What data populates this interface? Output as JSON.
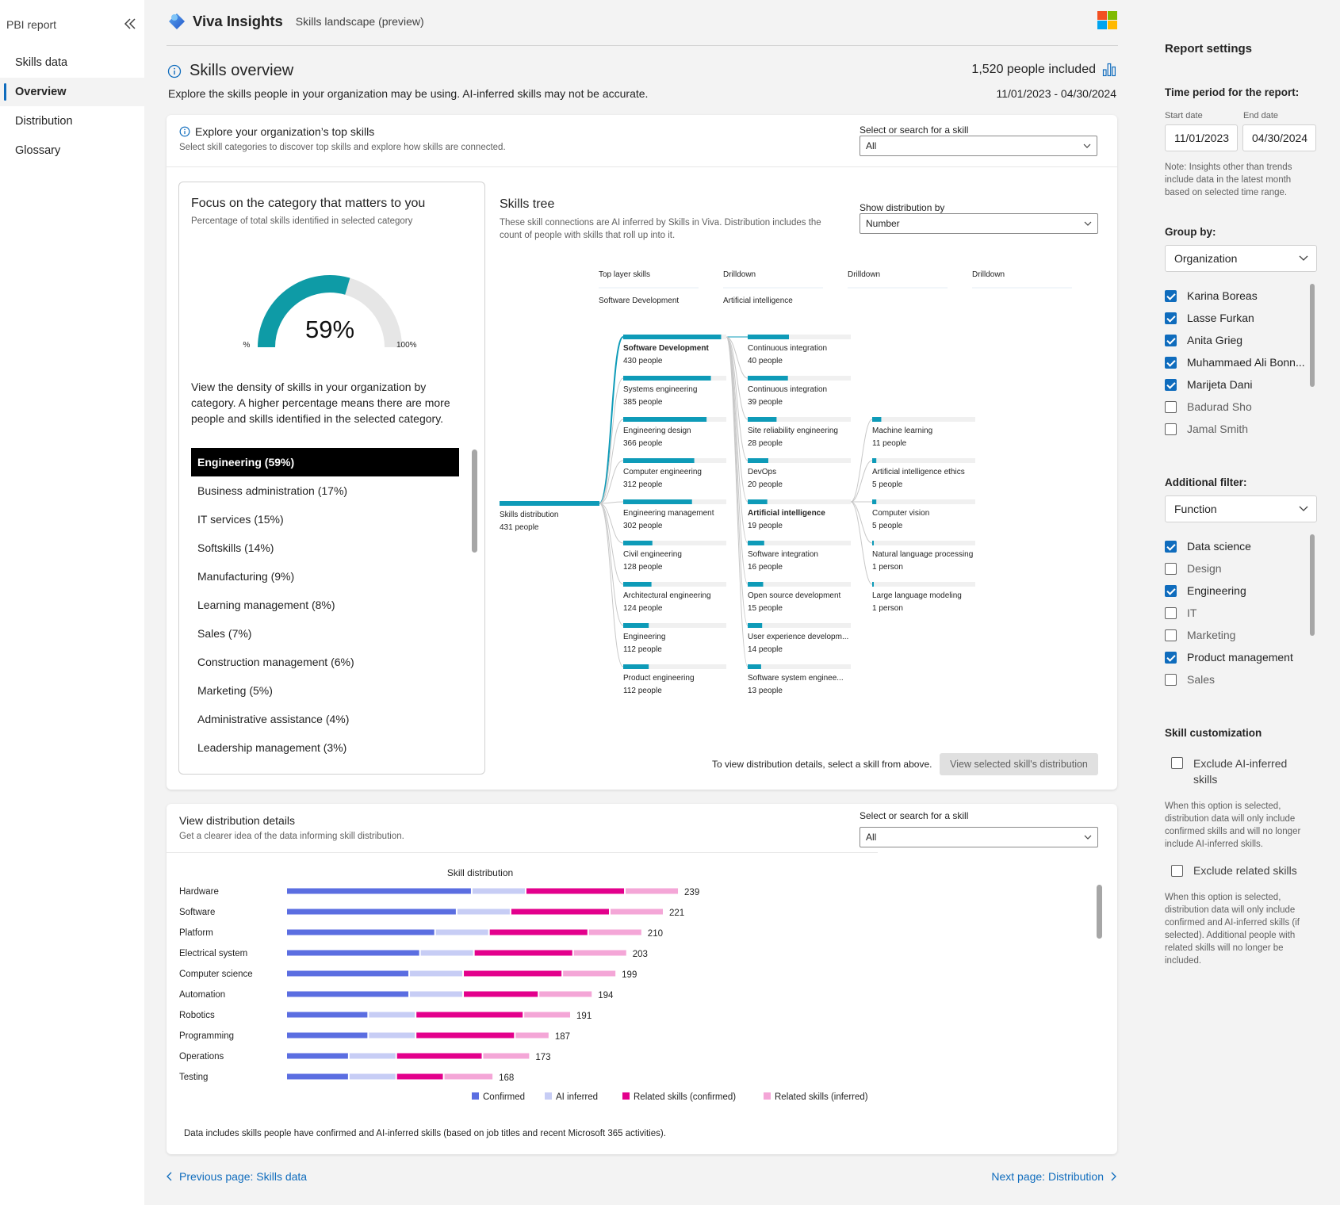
{
  "nav": {
    "title": "PBI report",
    "items": [
      "Skills data",
      "Overview",
      "Distribution",
      "Glossary"
    ],
    "active_index": 1
  },
  "header": {
    "brand": "Viva Insights",
    "subtitle": "Skills landscape (preview)"
  },
  "overview": {
    "title": "Skills overview",
    "description": "Explore the skills people in your organization may be using. AI-inferred skills may not be accurate.",
    "people_included": "1,520 people included",
    "date_range": "11/01/2023 - 04/30/2024"
  },
  "top_card": {
    "title": "Explore your organization’s top skills",
    "subtitle": "Select skill categories to discover top skills and explore how skills are connected.",
    "select_label": "Select or search for a skill",
    "select_value": "All"
  },
  "focus": {
    "title": "Focus on the category that matters to you",
    "subtitle": "Percentage of total skills identified in selected category",
    "gauge_value": 59,
    "gauge_label": "59%",
    "gauge_min": "0%",
    "gauge_max": "100%",
    "description": "View the density of skills in your organization by category. A higher percentage means there are more people and skills identified in the selected category.",
    "categories": [
      "Engineering (59%)",
      "Business administration (17%)",
      "IT services (15%)",
      "Softskills (14%)",
      "Manufacturing (9%)",
      "Learning management (8%)",
      "Sales (7%)",
      "Construction management (6%)",
      "Marketing (5%)",
      "Administrative assistance (4%)",
      "Leadership management (3%)"
    ]
  },
  "tree": {
    "title": "Skills tree",
    "subtitle": "These skill connections are AI inferred by Skills in Viva. Distribution includes the count of people with skills that roll up into it.",
    "show_by_label": "Show distribution by",
    "show_by_value": "Number",
    "col_headers": [
      "Top layer skills",
      "Drilldown",
      "Drilldown",
      "Drilldown"
    ],
    "breadcrumbs": [
      "Software Development",
      "Artificial intelligence"
    ],
    "root": {
      "name": "Skills distribution",
      "count": "431 people"
    },
    "level1": [
      {
        "name": "Software Development",
        "count": "430 people",
        "value": 430
      },
      {
        "name": "Systems engineering",
        "count": "385 people",
        "value": 385
      },
      {
        "name": "Engineering design",
        "count": "366 people",
        "value": 366
      },
      {
        "name": "Computer engineering",
        "count": "312 people",
        "value": 312
      },
      {
        "name": "Engineering management",
        "count": "302 people",
        "value": 302
      },
      {
        "name": "Civil engineering",
        "count": "128 people",
        "value": 128
      },
      {
        "name": "Architectural engineering",
        "count": "124 people",
        "value": 124
      },
      {
        "name": "Engineering",
        "count": "112 people",
        "value": 112
      },
      {
        "name": "Product engineering",
        "count": "112 people",
        "value": 112
      }
    ],
    "level2": [
      {
        "name": "Continuous integration",
        "count": "40 people",
        "value": 40
      },
      {
        "name": "Continuous integration",
        "count": "39 people",
        "value": 39
      },
      {
        "name": "Site reliability engineering",
        "count": "28 people",
        "value": 28
      },
      {
        "name": "DevOps",
        "count": "20 people",
        "value": 20
      },
      {
        "name": "Artificial intelligence",
        "count": "19 people",
        "value": 19
      },
      {
        "name": "Software integration",
        "count": "16 people",
        "value": 16
      },
      {
        "name": "Open source development",
        "count": "15 people",
        "value": 15
      },
      {
        "name": "User experience developm...",
        "count": "14 people",
        "value": 14
      },
      {
        "name": "Software system enginee...",
        "count": "13 people",
        "value": 13
      }
    ],
    "level3": [
      {
        "name": "Machine learning",
        "count": "11 people",
        "value": 11
      },
      {
        "name": "Artificial intelligence ethics",
        "count": "5 people",
        "value": 5
      },
      {
        "name": "Computer vision",
        "count": "5 people",
        "value": 5
      },
      {
        "name": "Natural language processing",
        "count": "1 person",
        "value": 1
      },
      {
        "name": "Large language modeling",
        "count": "1 person",
        "value": 1
      }
    ],
    "note": "To view distribution details, select a skill from above.",
    "button": "View selected skill's distribution",
    "bar_color": "#0e9bb8"
  },
  "bottom_card": {
    "title": "View distribution details",
    "subtitle": "Get a clearer idea of the data informing skill distribution.",
    "select_label": "Select or search for a skill",
    "select_value": "All",
    "note": "Data includes skills people have confirmed and AI-inferred skills (based on job titles and recent Microsoft 365 activities)."
  },
  "chart_data": {
    "type": "bar",
    "orientation": "horizontal",
    "stacked": true,
    "title": "Skill distribution",
    "categories": [
      "Hardware",
      "Software",
      "Platform",
      "Electrical system",
      "Computer science",
      "Automation",
      "Robotics",
      "Programming",
      "Operations",
      "Testing"
    ],
    "totals": [
      239,
      221,
      210,
      203,
      199,
      194,
      191,
      187,
      173,
      168
    ],
    "series": [
      {
        "name": "Confirmed",
        "color": "#5b6ee1",
        "values": [
          86,
          79,
          69,
          62,
          57,
          57,
          38,
          38,
          29,
          29
        ]
      },
      {
        "name": "AI inferred",
        "color": "#c7cdf5",
        "values": [
          25,
          25,
          25,
          25,
          25,
          25,
          22,
          22,
          22,
          22
        ]
      },
      {
        "name": "Related skills (confirmed)",
        "color": "#e3008c",
        "values": [
          46,
          46,
          46,
          46,
          46,
          35,
          50,
          46,
          40,
          22
        ]
      },
      {
        "name": "Related skills (inferred)",
        "color": "#f4a6d7",
        "values": [
          25,
          25,
          25,
          25,
          25,
          25,
          22,
          16,
          22,
          23
        ]
      }
    ],
    "legend_position": "bottom"
  },
  "footer": {
    "prev": "Previous page: Skills data",
    "next": "Next page: Distribution"
  },
  "settings": {
    "title": "Report settings",
    "time_label": "Time period for the report:",
    "start_label": "Start date",
    "end_label": "End date",
    "start_value": "11/01/2023",
    "end_value": "04/30/2024",
    "time_note": "Note: Insights other than trends include data in the latest month based on selected time range.",
    "group_label": "Group by:",
    "group_value": "Organization",
    "group_items": [
      {
        "label": "Karina Boreas",
        "checked": true
      },
      {
        "label": "Lasse Furkan",
        "checked": true
      },
      {
        "label": "Anita Grieg",
        "checked": true
      },
      {
        "label": "Muhammaed Ali Bonn...",
        "checked": true
      },
      {
        "label": "Marijeta Dani",
        "checked": true
      },
      {
        "label": "Badurad Sho",
        "checked": false
      },
      {
        "label": "Jamal Smith",
        "checked": false
      }
    ],
    "filter_label": "Additional filter:",
    "filter_value": "Function",
    "filter_items": [
      {
        "label": "Data science",
        "checked": true
      },
      {
        "label": "Design",
        "checked": false
      },
      {
        "label": "Engineering",
        "checked": true
      },
      {
        "label": "IT",
        "checked": false
      },
      {
        "label": "Marketing",
        "checked": false
      },
      {
        "label": "Product management",
        "checked": true
      },
      {
        "label": "Sales",
        "checked": false
      }
    ],
    "custom_label": "Skill customization",
    "exclude_ai_label": "Exclude AI-inferred skills",
    "exclude_ai_note": "When this option is selected, distribution data will only include confirmed skills and will no longer include AI-inferred skills.",
    "exclude_related_label": "Exclude related skills",
    "exclude_related_note": "When this option is selected, distribution data will only include confirmed and AI-inferred skills (if selected). Additional people with related skills will no longer be included."
  },
  "colors": {
    "accent": "#0f6cbd",
    "teal": "#0e9bb8"
  }
}
